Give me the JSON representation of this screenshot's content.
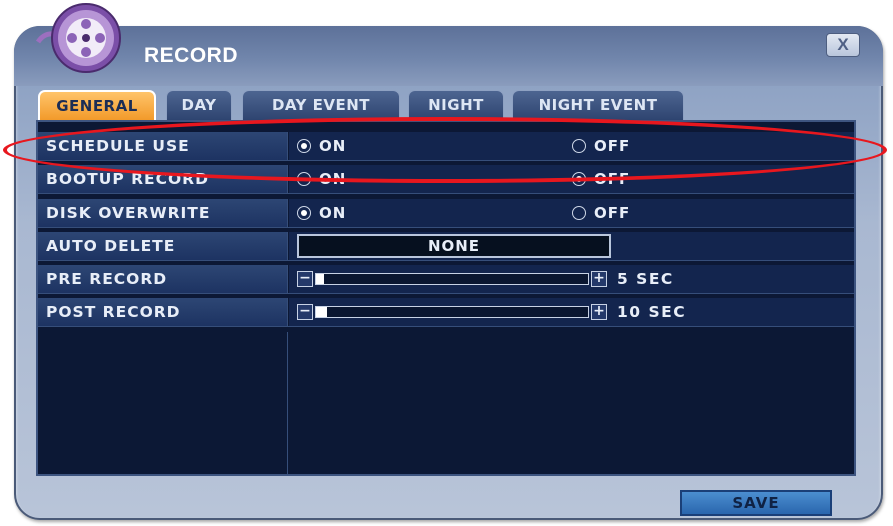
{
  "window": {
    "title": "RECORD",
    "close_label": "X"
  },
  "tabs": [
    {
      "label": "GENERAL",
      "active": true
    },
    {
      "label": "DAY",
      "active": false
    },
    {
      "label": "DAY EVENT",
      "active": false
    },
    {
      "label": "NIGHT",
      "active": false
    },
    {
      "label": "NIGHT EVENT",
      "active": false
    }
  ],
  "settings": {
    "schedule_use": {
      "label": "SCHEDULE USE",
      "on_label": "ON",
      "off_label": "OFF",
      "value": "ON"
    },
    "bootup_record": {
      "label": "BOOTUP RECORD",
      "on_label": "ON",
      "off_label": "OFF",
      "value": "OFF"
    },
    "disk_overwrite": {
      "label": "DISK OVERWRITE",
      "on_label": "ON",
      "off_label": "OFF",
      "value": "ON"
    },
    "auto_delete": {
      "label": "AUTO DELETE",
      "value": "NONE"
    },
    "pre_record": {
      "label": "PRE RECORD",
      "readout": "5 SEC",
      "level": 0.02,
      "minus": "−",
      "plus": "+"
    },
    "post_record": {
      "label": "POST RECORD",
      "readout": "10 SEC",
      "level": 0.04,
      "minus": "−",
      "plus": "+"
    }
  },
  "footer": {
    "save_label": "SAVE"
  },
  "colors": {
    "active_tab": "#f29a2a",
    "highlight": "#e8171e",
    "panel_bg": "#0c1835"
  },
  "icons": {
    "logo": "film-reel-icon",
    "close": "close-icon"
  }
}
